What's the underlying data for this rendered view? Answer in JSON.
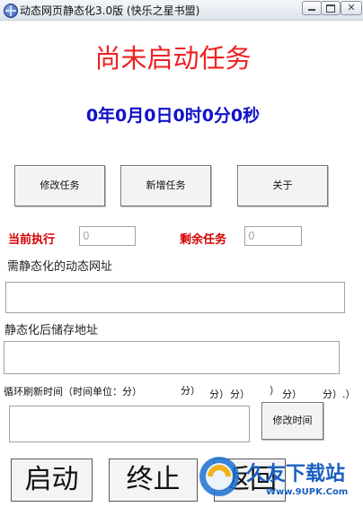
{
  "window": {
    "title": "动态网页静态化3.0版 (快乐之星书盟)"
  },
  "status": {
    "text": "尚未启动任务"
  },
  "timer": {
    "text": "0年0月0日0时0分0秒"
  },
  "toolbar": {
    "edit_task": "修改任务",
    "new_task": "新增任务",
    "about": "关于"
  },
  "tasks": {
    "current_label": "当前执行",
    "current_value": "0",
    "remaining_label": "剩余任务",
    "remaining_value": "0"
  },
  "dynamic_url": {
    "label": "需静态化的动态网址",
    "value": ""
  },
  "storage": {
    "label": "静态化后储存地址",
    "value": ""
  },
  "refresh": {
    "label": "循环刷新时间（时间单位：分）",
    "fragments": [
      "分）",
      "分）",
      "分）",
      "）",
      "分）",
      "分）.）"
    ],
    "modify_button": "修改时间"
  },
  "actions": {
    "start": "启动",
    "stop": "终止",
    "back": "返回"
  },
  "watermark": {
    "brand": "久友下载站",
    "url": "Www.9UPK.Com"
  },
  "colors": {
    "status": "#ee2222",
    "timer": "#1111cc",
    "labels": "#d40000"
  }
}
